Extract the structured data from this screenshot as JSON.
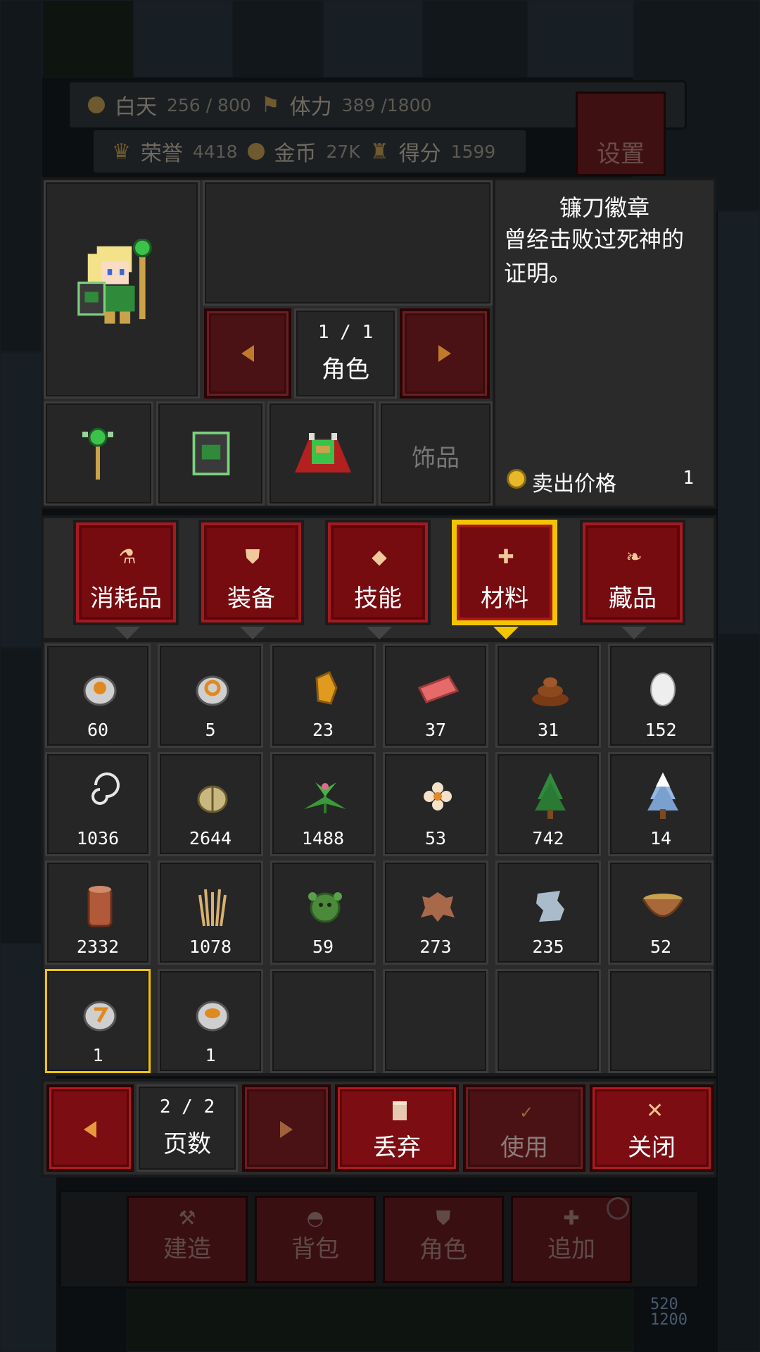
{
  "status": {
    "day_label": "白天",
    "day_value": "256 / 800",
    "stamina_label": "体力",
    "stamina_value": "389 /1800",
    "honor_label": "荣誉",
    "honor_value": "4418",
    "gold_label": "金币",
    "gold_value": "27K",
    "score_label": "得分",
    "score_value": "1599",
    "settings_label": "设置"
  },
  "character": {
    "page": "1 / 1",
    "page_label": "角色",
    "accessory_label": "饰品"
  },
  "detail": {
    "title": "镰刀徽章",
    "description": "曾经击败过死神的证明。",
    "sell_label": "卖出价格",
    "sell_value": "1"
  },
  "tabs": [
    {
      "label": "消耗品",
      "selected": false
    },
    {
      "label": "装备",
      "selected": false
    },
    {
      "label": "技能",
      "selected": false
    },
    {
      "label": "材料",
      "selected": true
    },
    {
      "label": "藏品",
      "selected": false
    }
  ],
  "items": [
    {
      "icon": "badge-skull-icon",
      "count": "60"
    },
    {
      "icon": "badge-swirl-icon",
      "count": "5"
    },
    {
      "icon": "amber-shard-icon",
      "count": "23"
    },
    {
      "icon": "raw-meat-icon",
      "count": "37"
    },
    {
      "icon": "dung-icon",
      "count": "31"
    },
    {
      "icon": "egg-icon",
      "count": "152"
    },
    {
      "icon": "spiral-thread-icon",
      "count": "1036"
    },
    {
      "icon": "seed-pod-icon",
      "count": "2644"
    },
    {
      "icon": "herb-plant-icon",
      "count": "1488"
    },
    {
      "icon": "flower-icon",
      "count": "53"
    },
    {
      "icon": "pine-tree-icon",
      "count": "742"
    },
    {
      "icon": "snowy-pine-icon",
      "count": "14"
    },
    {
      "icon": "log-icon",
      "count": "2332"
    },
    {
      "icon": "wheat-icon",
      "count": "1078"
    },
    {
      "icon": "green-slime-icon",
      "count": "59"
    },
    {
      "icon": "leather-hide-icon",
      "count": "273"
    },
    {
      "icon": "cloth-scrap-icon",
      "count": "235"
    },
    {
      "icon": "bowl-icon",
      "count": "52"
    },
    {
      "icon": "badge-scythe-icon",
      "count": "1"
    },
    {
      "icon": "badge-face-icon",
      "count": "1"
    }
  ],
  "footer": {
    "page": "2 / 2",
    "page_label": "页数",
    "discard_label": "丢弃",
    "use_label": "使用",
    "close_label": "关闭"
  },
  "bottom_nav": {
    "build": "建造",
    "bag": "背包",
    "character": "角色",
    "add": "追加",
    "stat1": "520",
    "stat2": "1200"
  },
  "colors": {
    "accent_red": "#7c0d12",
    "selected_gold": "#f2c500",
    "panel": "#2b2b2b"
  }
}
